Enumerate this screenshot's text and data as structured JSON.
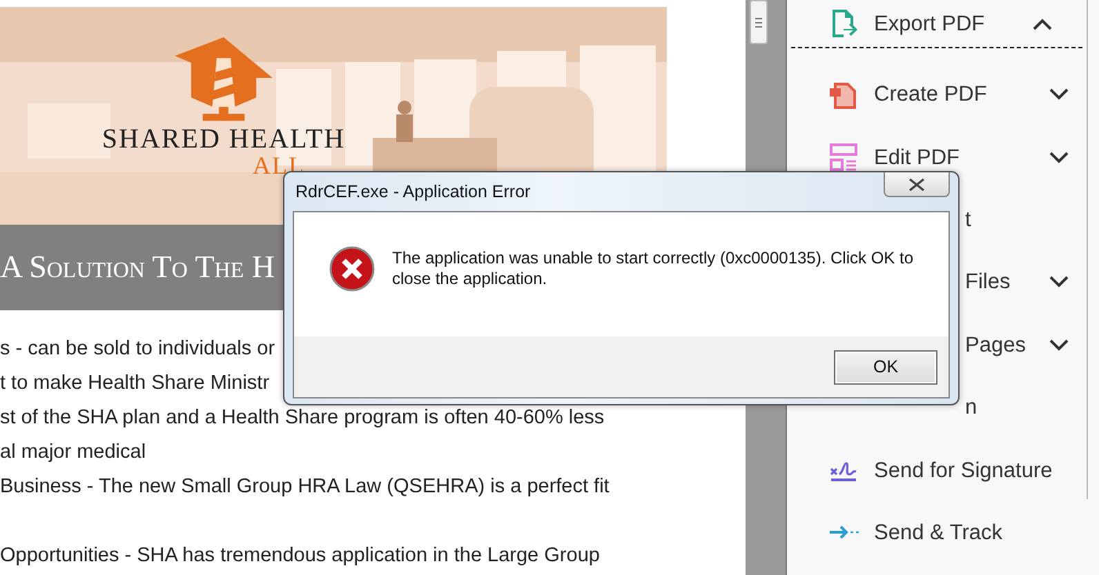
{
  "document": {
    "logo": {
      "name": "SHARED HEALTH",
      "tagline": "ALL"
    },
    "heading": "A Solution To The H",
    "paragraphs": [
      [
        "s - can be sold to individuals or",
        "t to make Health Share Ministr",
        "st of the SHA plan and a Health Share program is often 40-60% less",
        "al major medical",
        "Business - The new Small Group HRA Law (QSEHRA) is a perfect fit"
      ],
      [
        "Opportunities - SHA has tremendous application in the Large Group"
      ]
    ]
  },
  "tools": [
    {
      "kind": "export",
      "label": "Export PDF",
      "menu": true,
      "expanded": true
    },
    {
      "kind": "create",
      "label": "Create PDF",
      "menu": true,
      "expanded": false
    },
    {
      "kind": "edit",
      "label": "Edit PDF",
      "menu": true,
      "expanded": false
    },
    {
      "kind": "covered",
      "label": "t",
      "menu": false
    },
    {
      "kind": "covered",
      "label": "Files",
      "menu": true,
      "expanded": false
    },
    {
      "kind": "covered",
      "label": "Pages",
      "menu": true,
      "expanded": false
    },
    {
      "kind": "covered",
      "label": "n",
      "menu": false
    },
    {
      "kind": "sign",
      "label": "Send for Signature",
      "menu": false
    },
    {
      "kind": "track",
      "label": "Send & Track",
      "menu": false
    }
  ],
  "dialog": {
    "title": "RdrCEF.exe - Application Error",
    "message": "The application was unable to start correctly (0xc0000135). Click OK to close the application.",
    "button": "OK"
  }
}
